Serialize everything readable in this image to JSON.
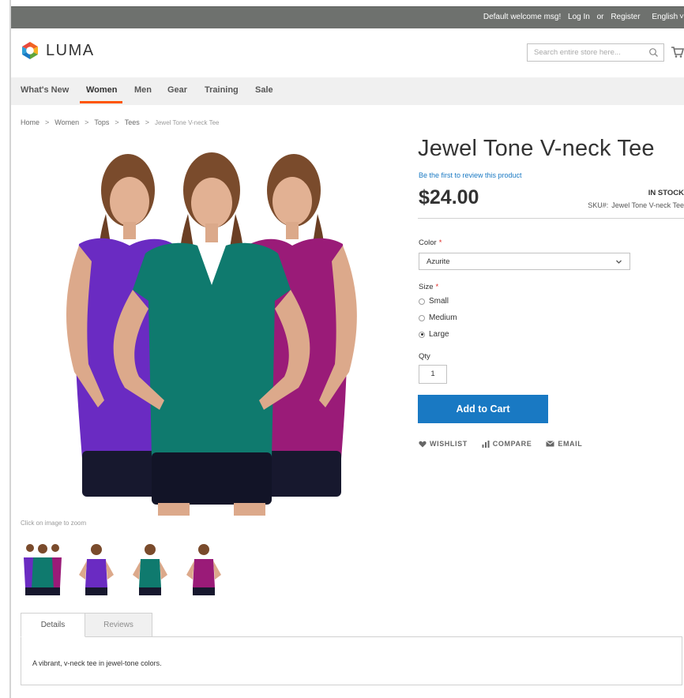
{
  "panel": {
    "welcome": "Default welcome msg!",
    "login": "Log In",
    "or": "or",
    "register": "Register",
    "language": "English"
  },
  "header": {
    "logo_text": "LUMA",
    "search_placeholder": "Search entire store here...",
    "brand_colors": {
      "orange": "#f26322",
      "blue": "#1979c3",
      "yellow": "#f6b221",
      "green": "#5fa53a"
    }
  },
  "nav": {
    "items": [
      {
        "label": "What's New"
      },
      {
        "label": "Women",
        "active": true
      },
      {
        "label": "Men"
      },
      {
        "label": "Gear"
      },
      {
        "label": "Training"
      },
      {
        "label": "Sale"
      }
    ],
    "active_color": "#ff5501"
  },
  "breadcrumb": {
    "items": [
      "Home",
      "Women",
      "Tops",
      "Tees"
    ],
    "current": "Jewel Tone V-neck Tee"
  },
  "gallery": {
    "zoom_hint": "Click on image to zoom",
    "shirt_colors": [
      "#6a2bc2",
      "#0f7a6e",
      "#9a1b78"
    ],
    "thumbnails": [
      {
        "name": "all-colors"
      },
      {
        "name": "purple",
        "color": "#6a2bc2"
      },
      {
        "name": "teal",
        "color": "#0f7a6e"
      },
      {
        "name": "magenta",
        "color": "#9a1b78"
      }
    ]
  },
  "product": {
    "title": "Jewel Tone V-neck Tee",
    "review_link": "Be the first to review this product",
    "price": "$24.00",
    "stock": "IN STOCK",
    "sku_label": "SKU#:",
    "sku": "Jewel Tone V-neck Tee"
  },
  "options": {
    "color_label": "Color",
    "required_mark": "*",
    "color_value": "Azurite",
    "size_label": "Size",
    "sizes": [
      {
        "label": "Small",
        "checked": false
      },
      {
        "label": "Medium",
        "checked": false
      },
      {
        "label": "Large",
        "checked": true
      }
    ],
    "qty_label": "Qty",
    "qty_value": "1"
  },
  "actions": {
    "add_to_cart": "Add to Cart",
    "wishlist": "WISHLIST",
    "compare": "COMPARE",
    "email": "EMAIL"
  },
  "tabs": {
    "items": [
      {
        "label": "Details",
        "active": true
      },
      {
        "label": "Reviews",
        "active": false
      }
    ],
    "details_text": "A vibrant, v-neck tee in jewel-tone colors."
  }
}
